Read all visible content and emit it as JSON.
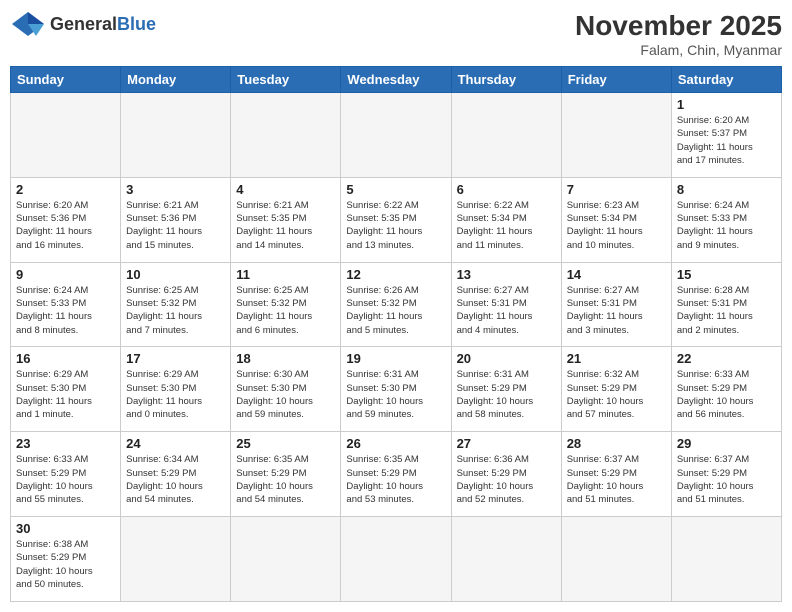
{
  "header": {
    "logo_general": "General",
    "logo_blue": "Blue",
    "month_title": "November 2025",
    "location": "Falam, Chin, Myanmar"
  },
  "days_of_week": [
    "Sunday",
    "Monday",
    "Tuesday",
    "Wednesday",
    "Thursday",
    "Friday",
    "Saturday"
  ],
  "weeks": [
    [
      {
        "day": "",
        "info": ""
      },
      {
        "day": "",
        "info": ""
      },
      {
        "day": "",
        "info": ""
      },
      {
        "day": "",
        "info": ""
      },
      {
        "day": "",
        "info": ""
      },
      {
        "day": "",
        "info": ""
      },
      {
        "day": "1",
        "info": "Sunrise: 6:20 AM\nSunset: 5:37 PM\nDaylight: 11 hours\nand 17 minutes."
      }
    ],
    [
      {
        "day": "2",
        "info": "Sunrise: 6:20 AM\nSunset: 5:36 PM\nDaylight: 11 hours\nand 16 minutes."
      },
      {
        "day": "3",
        "info": "Sunrise: 6:21 AM\nSunset: 5:36 PM\nDaylight: 11 hours\nand 15 minutes."
      },
      {
        "day": "4",
        "info": "Sunrise: 6:21 AM\nSunset: 5:35 PM\nDaylight: 11 hours\nand 14 minutes."
      },
      {
        "day": "5",
        "info": "Sunrise: 6:22 AM\nSunset: 5:35 PM\nDaylight: 11 hours\nand 13 minutes."
      },
      {
        "day": "6",
        "info": "Sunrise: 6:22 AM\nSunset: 5:34 PM\nDaylight: 11 hours\nand 11 minutes."
      },
      {
        "day": "7",
        "info": "Sunrise: 6:23 AM\nSunset: 5:34 PM\nDaylight: 11 hours\nand 10 minutes."
      },
      {
        "day": "8",
        "info": "Sunrise: 6:24 AM\nSunset: 5:33 PM\nDaylight: 11 hours\nand 9 minutes."
      }
    ],
    [
      {
        "day": "9",
        "info": "Sunrise: 6:24 AM\nSunset: 5:33 PM\nDaylight: 11 hours\nand 8 minutes."
      },
      {
        "day": "10",
        "info": "Sunrise: 6:25 AM\nSunset: 5:32 PM\nDaylight: 11 hours\nand 7 minutes."
      },
      {
        "day": "11",
        "info": "Sunrise: 6:25 AM\nSunset: 5:32 PM\nDaylight: 11 hours\nand 6 minutes."
      },
      {
        "day": "12",
        "info": "Sunrise: 6:26 AM\nSunset: 5:32 PM\nDaylight: 11 hours\nand 5 minutes."
      },
      {
        "day": "13",
        "info": "Sunrise: 6:27 AM\nSunset: 5:31 PM\nDaylight: 11 hours\nand 4 minutes."
      },
      {
        "day": "14",
        "info": "Sunrise: 6:27 AM\nSunset: 5:31 PM\nDaylight: 11 hours\nand 3 minutes."
      },
      {
        "day": "15",
        "info": "Sunrise: 6:28 AM\nSunset: 5:31 PM\nDaylight: 11 hours\nand 2 minutes."
      }
    ],
    [
      {
        "day": "16",
        "info": "Sunrise: 6:29 AM\nSunset: 5:30 PM\nDaylight: 11 hours\nand 1 minute."
      },
      {
        "day": "17",
        "info": "Sunrise: 6:29 AM\nSunset: 5:30 PM\nDaylight: 11 hours\nand 0 minutes."
      },
      {
        "day": "18",
        "info": "Sunrise: 6:30 AM\nSunset: 5:30 PM\nDaylight: 10 hours\nand 59 minutes."
      },
      {
        "day": "19",
        "info": "Sunrise: 6:31 AM\nSunset: 5:30 PM\nDaylight: 10 hours\nand 59 minutes."
      },
      {
        "day": "20",
        "info": "Sunrise: 6:31 AM\nSunset: 5:29 PM\nDaylight: 10 hours\nand 58 minutes."
      },
      {
        "day": "21",
        "info": "Sunrise: 6:32 AM\nSunset: 5:29 PM\nDaylight: 10 hours\nand 57 minutes."
      },
      {
        "day": "22",
        "info": "Sunrise: 6:33 AM\nSunset: 5:29 PM\nDaylight: 10 hours\nand 56 minutes."
      }
    ],
    [
      {
        "day": "23",
        "info": "Sunrise: 6:33 AM\nSunset: 5:29 PM\nDaylight: 10 hours\nand 55 minutes."
      },
      {
        "day": "24",
        "info": "Sunrise: 6:34 AM\nSunset: 5:29 PM\nDaylight: 10 hours\nand 54 minutes."
      },
      {
        "day": "25",
        "info": "Sunrise: 6:35 AM\nSunset: 5:29 PM\nDaylight: 10 hours\nand 54 minutes."
      },
      {
        "day": "26",
        "info": "Sunrise: 6:35 AM\nSunset: 5:29 PM\nDaylight: 10 hours\nand 53 minutes."
      },
      {
        "day": "27",
        "info": "Sunrise: 6:36 AM\nSunset: 5:29 PM\nDaylight: 10 hours\nand 52 minutes."
      },
      {
        "day": "28",
        "info": "Sunrise: 6:37 AM\nSunset: 5:29 PM\nDaylight: 10 hours\nand 51 minutes."
      },
      {
        "day": "29",
        "info": "Sunrise: 6:37 AM\nSunset: 5:29 PM\nDaylight: 10 hours\nand 51 minutes."
      }
    ],
    [
      {
        "day": "30",
        "info": "Sunrise: 6:38 AM\nSunset: 5:29 PM\nDaylight: 10 hours\nand 50 minutes."
      },
      {
        "day": "",
        "info": ""
      },
      {
        "day": "",
        "info": ""
      },
      {
        "day": "",
        "info": ""
      },
      {
        "day": "",
        "info": ""
      },
      {
        "day": "",
        "info": ""
      },
      {
        "day": "",
        "info": ""
      }
    ]
  ]
}
